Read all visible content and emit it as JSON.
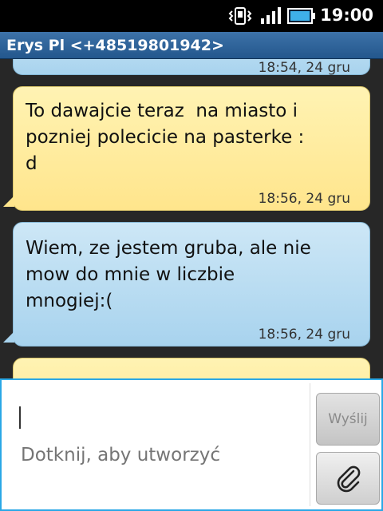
{
  "status_bar": {
    "time": "19:00",
    "icons": [
      "vibrate-icon",
      "signal-icon",
      "battery-icon"
    ]
  },
  "header": {
    "title": "Erys Pl <+48519801942>"
  },
  "messages": [
    {
      "type": "received",
      "text": "",
      "timestamp": "18:54, 24 gru",
      "color": "#a8d3ee"
    },
    {
      "type": "sent",
      "text": "To dawajcie teraz  na miasto i\npozniej polecicie na pasterke :\nd",
      "timestamp": "18:56, 24 gru",
      "color": "#ffe58c"
    },
    {
      "type": "received",
      "text": "Wiem, ze jestem gruba, ale nie\nmow do mnie w liczbie\nmnogiej:(",
      "timestamp": "18:56, 24 gru",
      "color": "#a8d3ee"
    },
    {
      "type": "sent",
      "text": "",
      "timestamp": "",
      "color": "#ffe58c"
    }
  ],
  "compose": {
    "placeholder": "Dotknij, aby utworzyć",
    "send_label": "Wyślij",
    "attach_icon": "paperclip-icon"
  },
  "colors": {
    "accent_border": "#2aa8e6",
    "title_bar": "#2f65a0"
  }
}
